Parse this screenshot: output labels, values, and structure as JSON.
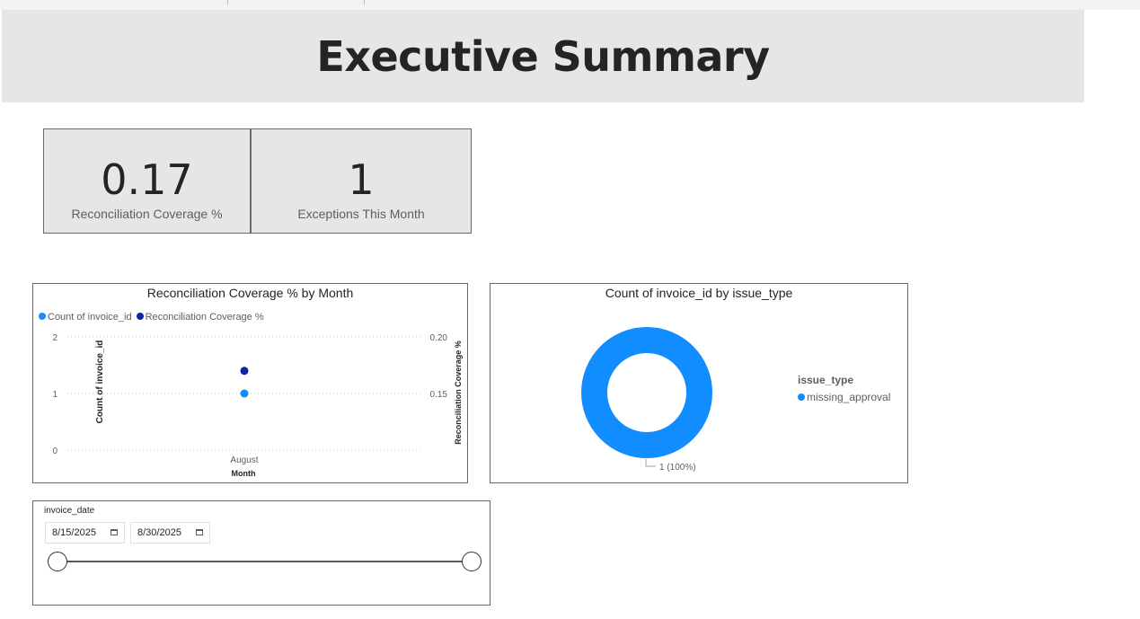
{
  "page": {
    "title": "Executive Summary"
  },
  "cards": [
    {
      "value": "0.17",
      "label": "Reconciliation Coverage %"
    },
    {
      "value": "1",
      "label": "Exceptions This Month"
    }
  ],
  "combo_chart": {
    "title": "Reconciliation Coverage % by Month",
    "legend": [
      {
        "label": "Count of invoice_id",
        "color": "#118dff"
      },
      {
        "label": "Reconciliation Coverage %",
        "color": "#12239e"
      }
    ],
    "y_left_label": "Count of invoice_id",
    "y_left_ticks": [
      "2",
      "1",
      "0"
    ],
    "y_right_label": "Reconciliation Coverage %",
    "y_right_ticks": [
      "0.20",
      "0.15"
    ],
    "x_label": "Month",
    "x_ticks": [
      "August"
    ]
  },
  "donut_chart": {
    "title": "Count of invoice_id by issue_type",
    "legend_title": "issue_type",
    "legend_item": "missing_approval",
    "data_label": "1 (100%)",
    "color": "#118dff"
  },
  "slicer": {
    "title": "invoice_date",
    "start_date": "8/15/2025",
    "end_date": "8/30/2025",
    "calendar_icon": "calendar-icon"
  },
  "chart_data": [
    {
      "type": "scatter",
      "title": "Reconciliation Coverage % by Month",
      "categories": [
        "August"
      ],
      "series": [
        {
          "name": "Count of invoice_id",
          "axis": "left",
          "values": [
            1
          ]
        },
        {
          "name": "Reconciliation Coverage %",
          "axis": "right",
          "values": [
            0.17
          ]
        }
      ],
      "xlabel": "Month",
      "ylabel": "Count of invoice_id",
      "ylabel_right": "Reconciliation Coverage %",
      "ylim": [
        0,
        2
      ],
      "ylim_right": [
        0.1,
        0.2
      ],
      "grid": true,
      "legend": "top-left"
    },
    {
      "type": "pie",
      "title": "Count of invoice_id by issue_type",
      "categories": [
        "missing_approval"
      ],
      "values": [
        1
      ],
      "legend": "right"
    }
  ]
}
